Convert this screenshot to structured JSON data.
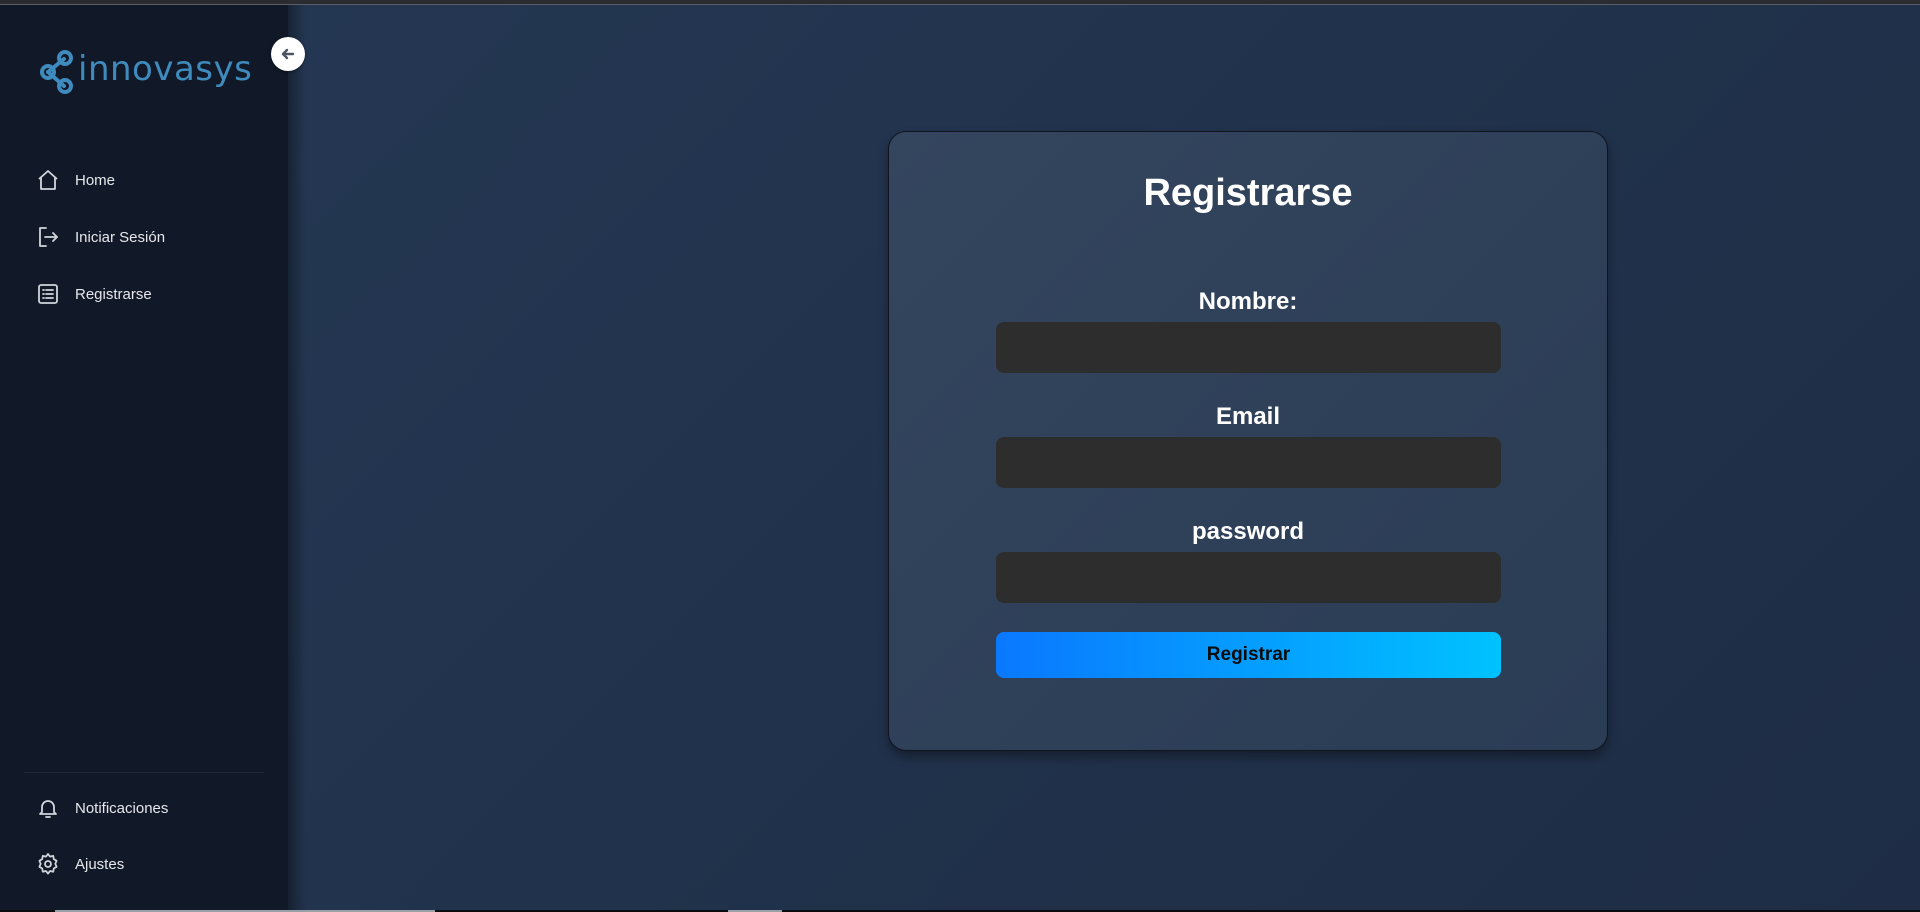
{
  "brand": {
    "name": "innovasys",
    "color": "#3f8bbd"
  },
  "sidebar": {
    "collapse_icon": "arrow-left-icon",
    "items": [
      {
        "label": "Home",
        "icon": "home-icon"
      },
      {
        "label": "Iniciar Sesión",
        "icon": "login-icon"
      },
      {
        "label": "Registrarse",
        "icon": "register-icon"
      }
    ],
    "bottom_items": [
      {
        "label": "Notificaciones",
        "icon": "bell-icon"
      },
      {
        "label": "Ajustes",
        "icon": "gear-icon"
      }
    ]
  },
  "form": {
    "title": "Registrarse",
    "fields": [
      {
        "label": "Nombre:",
        "value": "",
        "placeholder": ""
      },
      {
        "label": "Email",
        "value": "",
        "placeholder": ""
      },
      {
        "label": "password",
        "value": "",
        "placeholder": ""
      }
    ],
    "submit_label": "Registrar",
    "submit_gradient": [
      "#0a78ff",
      "#00c2ff"
    ]
  }
}
